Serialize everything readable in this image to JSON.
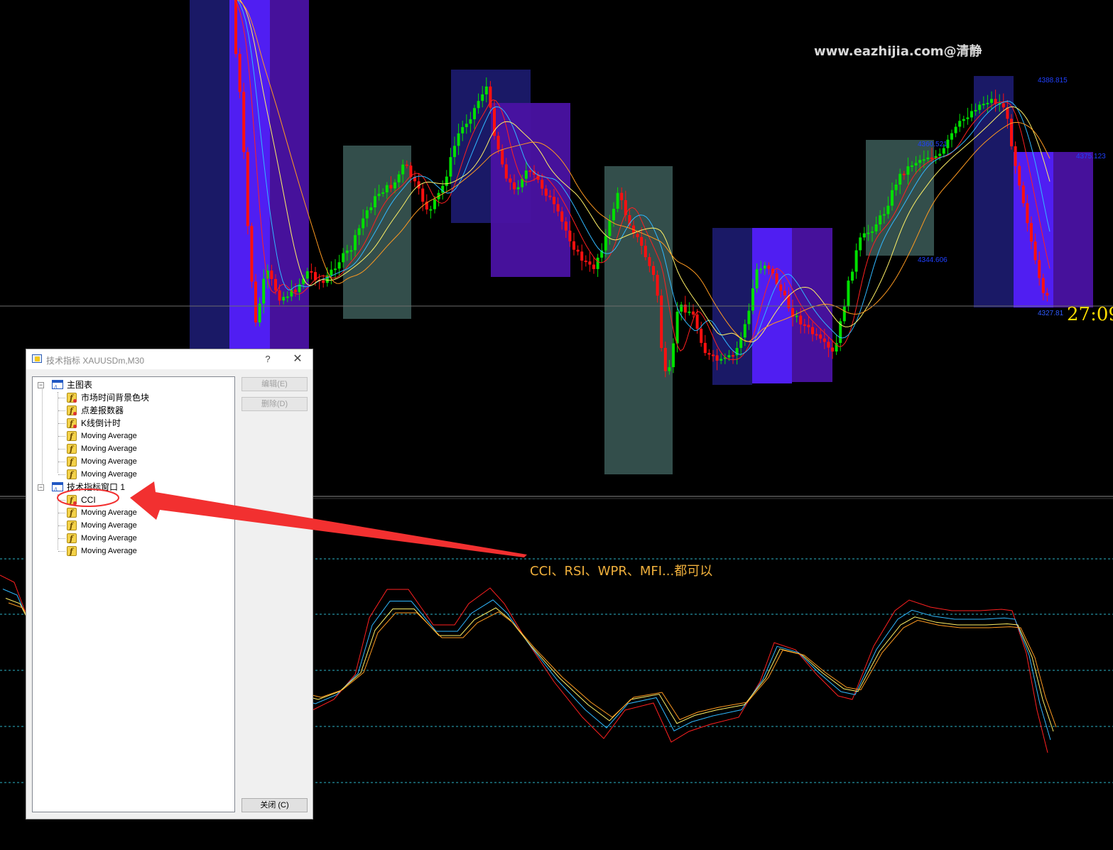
{
  "watermark": "www.eazhijia.com@清静",
  "countdown": "27:09",
  "price_labels": {
    "high1": "4388.815",
    "mid1": "4375.123",
    "mid_green": "4360.521",
    "low_green": "4344.606",
    "last": "4327.81"
  },
  "annotation": "CCI、RSI、WPR、MFI...都可以",
  "colors": {
    "background": "#000000",
    "bull_candle": "#00e000",
    "bear_candle": "#ff1010",
    "box_navy": "#1b1a6b",
    "box_violet": "#4a12a3",
    "box_bright": "#5420ff",
    "box_teal": "#36524f",
    "ma_red": "#ff2020",
    "ma_cyan": "#30b8ff",
    "ma_yellow": "#fff066",
    "ma_orange": "#ff9a20",
    "level_line": "#2bb5c9",
    "arrow": "#f23030"
  },
  "dialog": {
    "title": "技术指标 XAUUSDm,M30",
    "help": "?",
    "close_x": "✕",
    "tree": {
      "main_chart": {
        "label": "主图表",
        "toggle": "−",
        "items": [
          {
            "label": "市场时间背景色块",
            "special": true
          },
          {
            "label": "点差报数器",
            "special": true
          },
          {
            "label": "K线倒计时",
            "special": true
          },
          {
            "label": "Moving Average",
            "special": false
          },
          {
            "label": "Moving Average",
            "special": false
          },
          {
            "label": "Moving Average",
            "special": false
          },
          {
            "label": "Moving Average",
            "special": false
          }
        ]
      },
      "indicator_window": {
        "label": "技术指标窗口 1",
        "toggle": "−",
        "items": [
          {
            "label": "CCI",
            "special": true
          },
          {
            "label": "Moving Average",
            "special": false
          },
          {
            "label": "Moving Average",
            "special": false
          },
          {
            "label": "Moving Average",
            "special": false
          },
          {
            "label": "Moving Average",
            "special": false
          }
        ]
      }
    },
    "buttons": {
      "edit": "编辑(E)",
      "delete": "删除(D)",
      "close": "关闭 (C)"
    }
  }
}
